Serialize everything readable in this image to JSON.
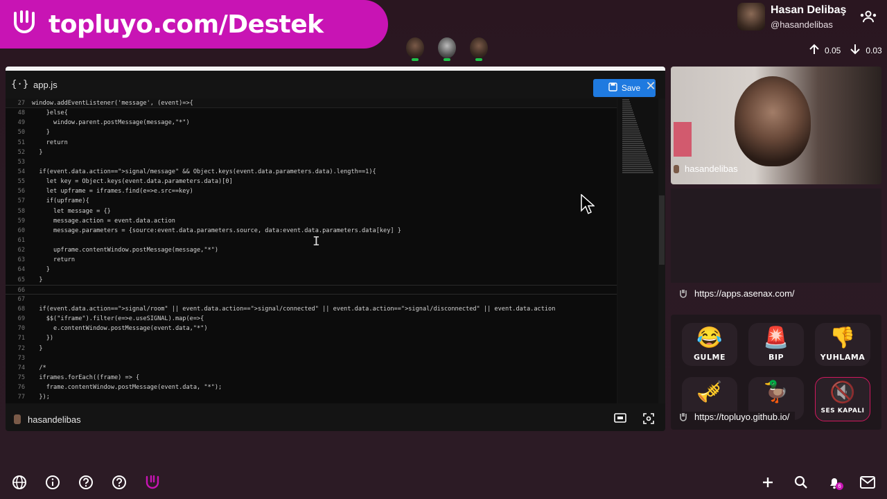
{
  "banner": {
    "text": "topluyo.com/Destek"
  },
  "user": {
    "name": "Hasan Delibaş",
    "handle": "@hasandelibas"
  },
  "netstats": {
    "up": "0.05",
    "down": "0.03"
  },
  "editor": {
    "filename": "app.js",
    "save_label": "Save",
    "sticky_line": {
      "num": "27",
      "text": "window.addEventListener('message', (event)=>{"
    },
    "lines": [
      {
        "num": "48",
        "text": "    }else{"
      },
      {
        "num": "49",
        "text": "      window.parent.postMessage(message,\"*\")"
      },
      {
        "num": "50",
        "text": "    }"
      },
      {
        "num": "51",
        "text": "    return"
      },
      {
        "num": "52",
        "text": "  }"
      },
      {
        "num": "53",
        "text": ""
      },
      {
        "num": "54",
        "text": "  if(event.data.action==\">signal/message\" && Object.keys(event.data.parameters.data).length==1){"
      },
      {
        "num": "55",
        "text": "    let key = Object.keys(event.data.parameters.data)[0]"
      },
      {
        "num": "56",
        "text": "    let upframe = iframes.find(e=>e.src==key)"
      },
      {
        "num": "57",
        "text": "    if(upframe){"
      },
      {
        "num": "58",
        "text": "      let message = {}"
      },
      {
        "num": "59",
        "text": "      message.action = event.data.action"
      },
      {
        "num": "60",
        "text": "      message.parameters = {source:event.data.parameters.source, data:event.data.parameters.data[key] }"
      },
      {
        "num": "61",
        "text": ""
      },
      {
        "num": "62",
        "text": "      upframe.contentWindow.postMessage(message,\"*\")"
      },
      {
        "num": "63",
        "text": "      return"
      },
      {
        "num": "64",
        "text": "    }"
      },
      {
        "num": "65",
        "text": "  }"
      },
      {
        "num": "66",
        "text": ""
      },
      {
        "num": "67",
        "text": ""
      },
      {
        "num": "68",
        "text": "  if(event.data.action==\">signal/room\" || event.data.action==\">signal/connected\" || event.data.action==\">signal/disconnected\" || event.data.action"
      },
      {
        "num": "69",
        "text": "    $$(\"iframe\").filter(e=>e.useSIGNAL).map(e=>{"
      },
      {
        "num": "70",
        "text": "      e.contentWindow.postMessage(event.data,\"*\")"
      },
      {
        "num": "71",
        "text": "    })"
      },
      {
        "num": "72",
        "text": "  }"
      },
      {
        "num": "73",
        "text": ""
      },
      {
        "num": "74",
        "text": "  /*"
      },
      {
        "num": "75",
        "text": "  iframes.forEach((frame) => {"
      },
      {
        "num": "76",
        "text": "    frame.contentWindow.postMessage(event.data, \"*\");"
      },
      {
        "num": "77",
        "text": "  });"
      }
    ],
    "footer_user": "hasandelibas"
  },
  "camera": {
    "label": "hasandelibas"
  },
  "urls": {
    "first": "https://apps.asenax.com/",
    "second": "https://topluyo.github.io/"
  },
  "sounds": [
    {
      "label": "GULME",
      "emoji": "😂"
    },
    {
      "label": "BIP",
      "emoji": "🚨"
    },
    {
      "label": "YUHLAMA",
      "emoji": "👎"
    },
    {
      "label": "",
      "emoji": "🎺"
    },
    {
      "label": "",
      "emoji": "🦆"
    },
    {
      "label": "SES KAPALI",
      "emoji": "🔇"
    }
  ],
  "notifications": {
    "count": "6"
  },
  "colors": {
    "brand": "#c814b4",
    "save": "#1f7ae0",
    "online": "#1fc24a"
  }
}
